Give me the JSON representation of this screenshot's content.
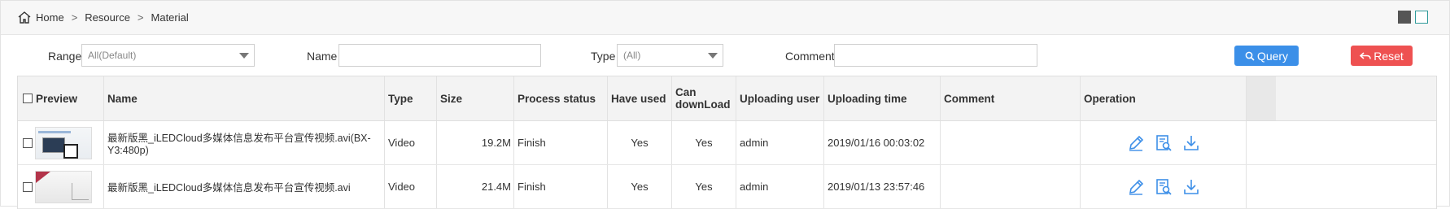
{
  "breadcrumb": {
    "items": [
      "Home",
      "Resource",
      "Material"
    ],
    "separator": ">"
  },
  "filters": {
    "range_label": "Range",
    "range_value": "All(Default)",
    "name_label": "Name",
    "name_value": "",
    "type_label": "Type",
    "type_value": "(All)",
    "comment_label": "Comment",
    "comment_value": "",
    "query_label": "Query",
    "reset_label": "Reset"
  },
  "table": {
    "headers": [
      "Preview",
      "Name",
      "Type",
      "Size",
      "Process status",
      "Have used",
      "Can downLoad",
      "Uploading user",
      "Uploading time",
      "Comment",
      "Operation"
    ],
    "rows": [
      {
        "name": "最新版黑_iLEDCloud多媒体信息发布平台宣传视频.avi(BX-Y3:480p)",
        "type": "Video",
        "size": "19.2M",
        "status": "Finish",
        "used": "Yes",
        "download": "Yes",
        "user": "admin",
        "time": "2019/01/16 00:03:02",
        "comment": ""
      },
      {
        "name": "最新版黑_iLEDCloud多媒体信息发布平台宣传视频.avi",
        "type": "Video",
        "size": "21.4M",
        "status": "Finish",
        "used": "Yes",
        "download": "Yes",
        "user": "admin",
        "time": "2019/01/13 23:57:46",
        "comment": ""
      }
    ]
  },
  "icons": [
    "home-icon",
    "search-icon",
    "undo-icon",
    "edit-icon",
    "preview-icon",
    "download-icon"
  ],
  "colors": {
    "query": "#3b8fe8",
    "reset": "#ee5151",
    "icon_blue": "#3d8fe8"
  }
}
